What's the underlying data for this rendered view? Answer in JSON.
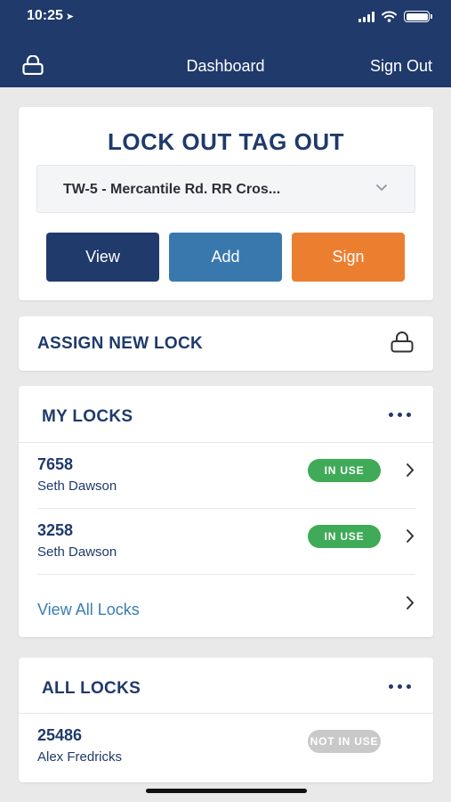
{
  "status_bar": {
    "time": "10:25",
    "location_icon": "location-arrow-icon",
    "signal_icon": "cellular-signal-icon",
    "wifi_icon": "wifi-icon",
    "battery_icon": "battery-icon"
  },
  "nav": {
    "title": "Dashboard",
    "sign_out": "Sign Out",
    "left_icon": "lock-icon"
  },
  "loto": {
    "title": "LOCK OUT TAG OUT",
    "selected_location": "TW-5 - Mercantile Rd. RR Cros...",
    "buttons": {
      "view": "View",
      "add": "Add",
      "sign": "Sign"
    }
  },
  "assign": {
    "label": "ASSIGN NEW LOCK",
    "icon": "lock-icon"
  },
  "my_locks": {
    "title": "MY LOCKS",
    "rows": [
      {
        "id": "7658",
        "owner": "Seth Dawson",
        "status": "IN USE"
      },
      {
        "id": "3258",
        "owner": "Seth Dawson",
        "status": "IN USE"
      }
    ],
    "view_all": "View All Locks"
  },
  "all_locks": {
    "title": "ALL LOCKS",
    "rows": [
      {
        "id": "25486",
        "owner": "Alex Fredricks",
        "status": "NOT IN USE"
      }
    ]
  },
  "colors": {
    "navy": "#1f3a6b",
    "blue": "#3978ad",
    "orange": "#ec7f2f",
    "green": "#3faa57",
    "gray_badge": "#c9c9c9"
  }
}
